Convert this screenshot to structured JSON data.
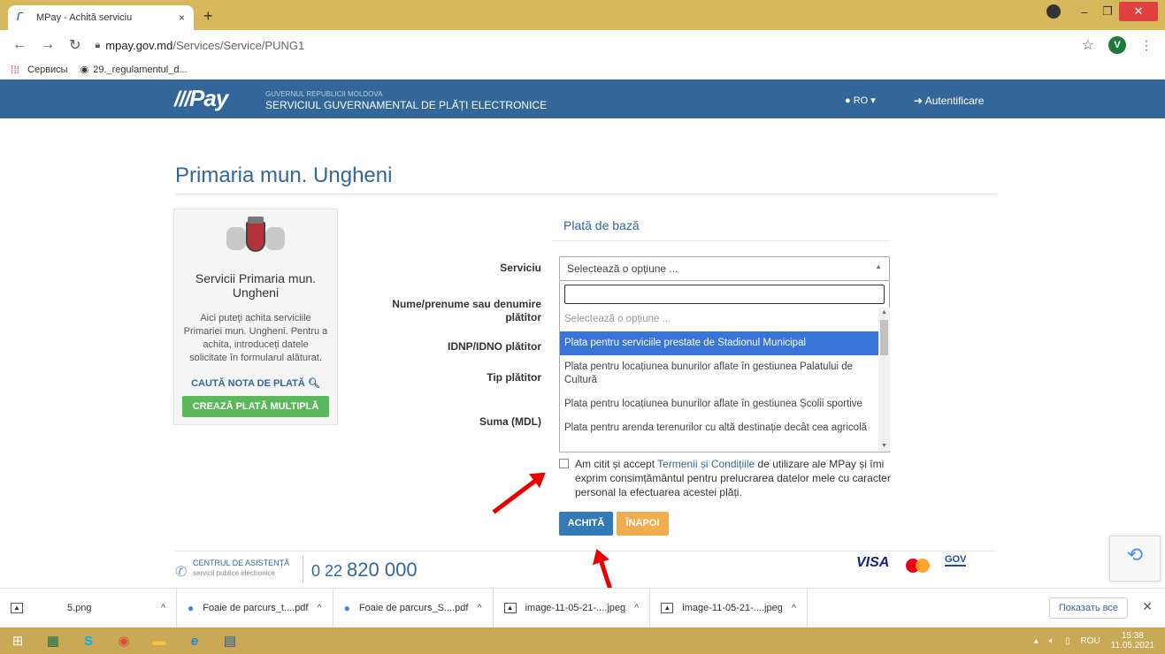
{
  "browser": {
    "tab_title": "MPay - Achită serviciu",
    "tab_close": "×",
    "new_tab": "+",
    "url_host": "mpay.gov.md",
    "url_path": "/Services/Service/PUNG1",
    "profile_initial": "V",
    "bookmarks": [
      "Сервисы",
      "29._regulamentul_d..."
    ],
    "window_controls": {
      "minimize": "–",
      "maximize": "❐",
      "close": "✕"
    }
  },
  "header": {
    "logo": "Pay",
    "gov_small": "GUVERNUL REPUBLICII MOLDOVA",
    "gov_big": "SERVICIUL GUVERNAMENTAL DE PLĂȚI ELECTRONICE",
    "lang": "RO",
    "login": "Autentificare"
  },
  "page": {
    "title": "Primaria mun. Ungheni"
  },
  "sidebar": {
    "title": "Servicii Primaria mun. Ungheni",
    "text": "Aici puteți achita serviciile Primariei mun. Ungheni. Pentru a achita, introduceți datele solicitate în formularul alăturat.",
    "search_link": "CAUTĂ NOTA DE PLATĂ",
    "multi_button": "CREAZĂ PLATĂ MULTIPLĂ"
  },
  "form": {
    "heading": "Plată de bază",
    "labels": {
      "service": "Serviciu",
      "name": "Nume/prenume sau denumire plătitor",
      "idnp": "IDNP/IDNO plătitor",
      "payer_type": "Tip plătitor",
      "amount": "Suma (MDL)"
    },
    "service_select": {
      "value": "Selectează o opțiune ...",
      "options": [
        "Selectează o opțiune ...",
        "Plata pentru serviciile prestate de Stadionul Municipal",
        "Plata pentru locațiunea bunurilor aflate în gestiunea Palatului de Cultură",
        "Plata pentru locațiunea bunurilor aflate în gestiunea Școlii sportive",
        "Plata pentru arenda terenurilor cu altă destinație decât cea agricolă"
      ],
      "highlighted_index": 1
    },
    "consent": {
      "before": "Am citit și accept ",
      "link": "Termenii și Condițiile",
      "after": " de utilizare ale MPay și îmi exprim consimțământul pentru prelucrarea datelor mele cu caracter personal la efectuarea acestei plăți."
    },
    "pay_button": "ACHITĂ",
    "back_button": "ÎNAPOI"
  },
  "footer": {
    "help_title": "CENTRUL DE ASISTENȚĂ",
    "help_sub": "servicii publice electronice",
    "phone_prefix": "0 22 ",
    "phone_number": "820 000",
    "visa": "VISA",
    "gov": "GOV"
  },
  "downloads": {
    "items": [
      "5.png",
      "Foaie de parcurs_t....pdf",
      "Foaie de parcurs_S....pdf",
      "image-11-05-21-....jpeg",
      "image-11-05-21-....jpeg"
    ],
    "show_all": "Показать все"
  },
  "taskbar": {
    "lang": "ROU",
    "time": "15:38",
    "date": "11.05.2021"
  },
  "colors": {
    "header_bg": "#336799",
    "pay_button": "#337ab7",
    "back_button": "#f0ad4e",
    "multi_button": "#5cb85c",
    "highlight": "#3875d7",
    "arrow": "#e80000"
  }
}
